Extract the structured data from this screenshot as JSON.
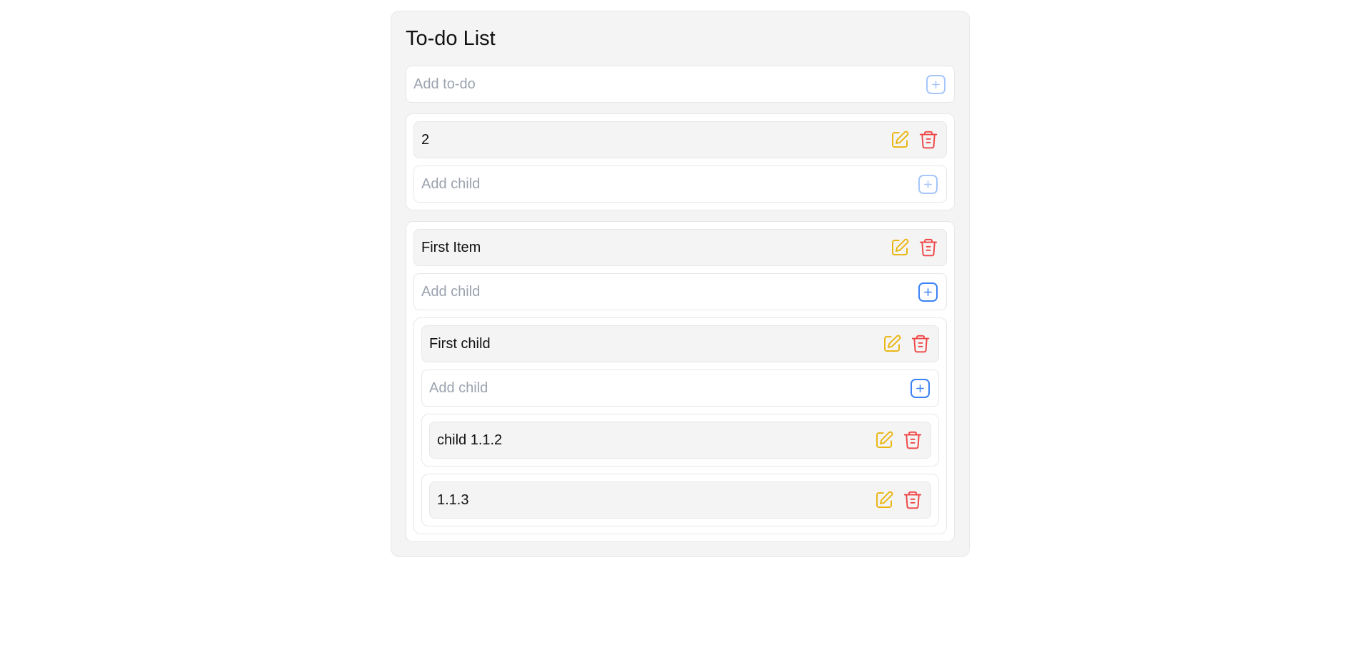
{
  "colors": {
    "accent_blue": "#3b82f6",
    "edit_yellow": "#eab308",
    "delete_red": "#ef4444",
    "placeholder_gray": "#9ca3af"
  },
  "page": {
    "title": "To-do List"
  },
  "add_todo": {
    "placeholder": "Add to-do",
    "icon": "plus-square-icon"
  },
  "todos": [
    {
      "text": "2",
      "add_child_placeholder": "Add child"
    },
    {
      "text": "First Item",
      "add_child_placeholder": "Add child",
      "children": [
        {
          "text": "First child",
          "add_child_placeholder": "Add child",
          "children": [
            {
              "text": "child 1.1.2"
            },
            {
              "text": "1.1.3"
            }
          ]
        }
      ]
    }
  ]
}
